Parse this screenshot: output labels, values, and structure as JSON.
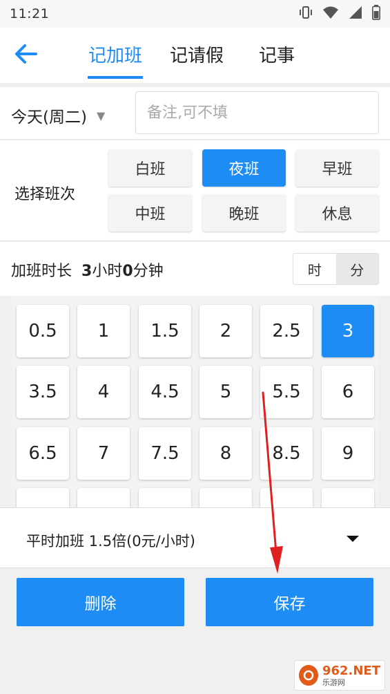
{
  "status_bar": {
    "time": "11:21",
    "icons": [
      "vibrate-icon",
      "wifi-icon",
      "signal-icon",
      "battery-icon"
    ]
  },
  "header": {
    "back_icon": "arrow-left-icon",
    "tabs": [
      {
        "label": "记加班",
        "active": true
      },
      {
        "label": "记请假",
        "active": false
      },
      {
        "label": "记事",
        "active": false
      }
    ],
    "accent_color": "#1e8cf5"
  },
  "date_row": {
    "date_label": "今天(周二)",
    "caret": "▼",
    "note_placeholder": "备注,可不填",
    "note_value": ""
  },
  "shift_row": {
    "label": "选择班次",
    "options": [
      {
        "label": "白班",
        "selected": false
      },
      {
        "label": "夜班",
        "selected": true
      },
      {
        "label": "早班",
        "selected": false
      },
      {
        "label": "中班",
        "selected": false
      },
      {
        "label": "晚班",
        "selected": false
      },
      {
        "label": "休息",
        "selected": false
      }
    ]
  },
  "duration_row": {
    "label": "加班时长",
    "hours": "3",
    "hours_unit": "小时",
    "minutes": "0",
    "minutes_unit": "分钟",
    "unit_options": [
      {
        "label": "时",
        "selected": false
      },
      {
        "label": "分",
        "selected": true
      }
    ]
  },
  "hour_grid": {
    "values": [
      "0.5",
      "1",
      "1.5",
      "2",
      "2.5",
      "3",
      "3.5",
      "4",
      "4.5",
      "5",
      "5.5",
      "6",
      "6.5",
      "7",
      "7.5",
      "8",
      "8.5",
      "9"
    ],
    "selected": "3"
  },
  "overtime_type": {
    "label": "平时加班 1.5倍(0元/小时)"
  },
  "actions": {
    "delete_label": "删除",
    "save_label": "保存"
  },
  "watermark": {
    "brand": "962.NET",
    "sub": "乐游网"
  }
}
